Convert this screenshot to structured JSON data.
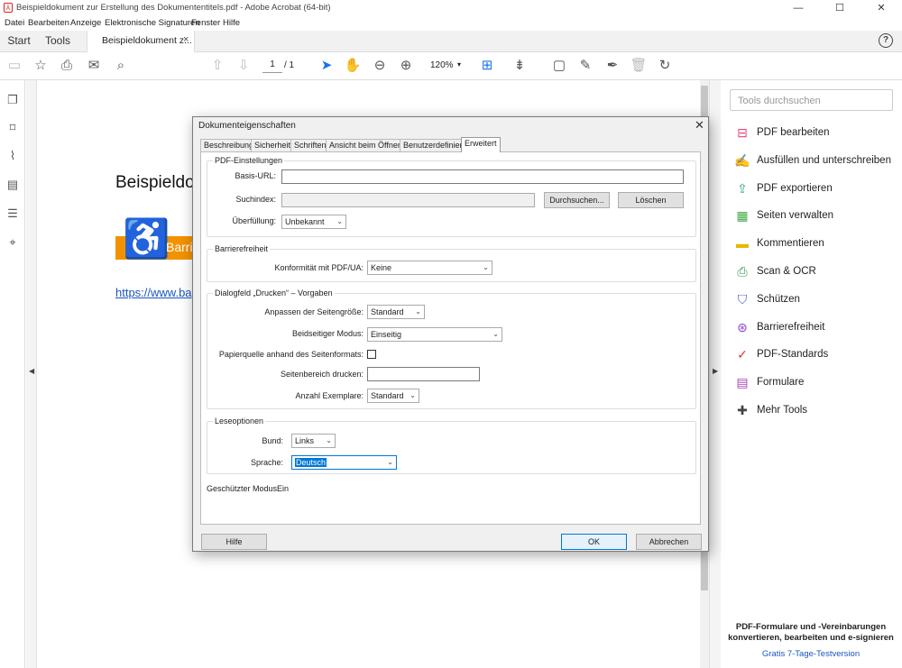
{
  "window": {
    "title": "Beispieldokument zur Erstellung des Dokumententitels.pdf - Adobe Acrobat (64-bit)",
    "minimize": "—",
    "maximize": "☐",
    "close": "✕"
  },
  "menu": [
    "Datei",
    "Bearbeiten",
    "Anzeige",
    "Elektronische Signaturen",
    "Fenster",
    "Hilfe"
  ],
  "tabs": {
    "start": "Start",
    "tools": "Tools",
    "document": "Beispieldokument z...",
    "close": "×"
  },
  "toolbar": {
    "page_current": "1",
    "page_total": "/ 1",
    "zoom": "120%"
  },
  "document": {
    "title": "Beispieldok",
    "badge_text": "Barri",
    "link": "https://www.ba"
  },
  "right_panel": {
    "search_placeholder": "Tools durchsuchen",
    "tools": [
      {
        "label": "PDF bearbeiten",
        "icon": "edit-pdf-icon",
        "color": "#e8457a"
      },
      {
        "label": "Ausfüllen und unterschreiben",
        "icon": "fill-sign-icon",
        "color": "#8a3fd1"
      },
      {
        "label": "PDF exportieren",
        "icon": "export-pdf-icon",
        "color": "#2ea37c"
      },
      {
        "label": "Seiten verwalten",
        "icon": "organize-pages-icon",
        "color": "#43a845"
      },
      {
        "label": "Kommentieren",
        "icon": "comment-icon",
        "color": "#e8b800"
      },
      {
        "label": "Scan & OCR",
        "icon": "scan-icon",
        "color": "#2e9a58"
      },
      {
        "label": "Schützen",
        "icon": "protect-icon",
        "color": "#4b5fd1"
      },
      {
        "label": "Barrierefreiheit",
        "icon": "accessibility-icon",
        "color": "#8a3fd1"
      },
      {
        "label": "PDF-Standards",
        "icon": "pdf-standards-icon",
        "color": "#d93a2b"
      },
      {
        "label": "Formulare",
        "icon": "forms-icon",
        "color": "#b03fc0"
      },
      {
        "label": "Mehr Tools",
        "icon": "more-tools-icon",
        "color": "#444444"
      }
    ],
    "promo_text": "PDF-Formulare und -Vereinbarungen konvertieren, bearbeiten und e-signieren",
    "promo_link": "Gratis 7-Tage-Testversion"
  },
  "dialog": {
    "title": "Dokumenteigenschaften",
    "close": "✕",
    "tabs": [
      "Beschreibung",
      "Sicherheit",
      "Schriften",
      "Ansicht beim Öffnen",
      "Benutzerdefiniert",
      "Erweitert"
    ],
    "pdf_settings": {
      "title": "PDF-Einstellungen",
      "base_url_label": "Basis-URL:",
      "base_url_value": "",
      "search_index_label": "Suchindex:",
      "browse_button": "Durchsuchen...",
      "delete_button": "Löschen",
      "trapping_label": "Überfüllung:",
      "trapping_value": "Unbekannt"
    },
    "accessibility": {
      "title": "Barrierefreiheit",
      "conformance_label": "Konformität mit PDF/UA:",
      "conformance_value": "Keine"
    },
    "print": {
      "title": "Dialogfeld „Drucken“ – Vorgaben",
      "page_scaling_label": "Anpassen der Seitengröße:",
      "page_scaling_value": "Standard",
      "duplex_label": "Beidseitiger Modus:",
      "duplex_value": "Einseitig",
      "paper_source_label": "Papierquelle anhand des Seitenformats:",
      "page_range_label": "Seitenbereich drucken:",
      "page_range_value": "",
      "copies_label": "Anzahl Exemplare:",
      "copies_value": "Standard"
    },
    "reading": {
      "title": "Leseoptionen",
      "binding_label": "Bund:",
      "binding_value": "Links",
      "language_label": "Sprache:",
      "language_value": "Deutsch"
    },
    "protected_mode_label": "Geschützter Modus:",
    "protected_mode_value": "Ein",
    "buttons": {
      "help": "Hilfe",
      "ok": "OK",
      "cancel": "Abbrechen"
    }
  }
}
